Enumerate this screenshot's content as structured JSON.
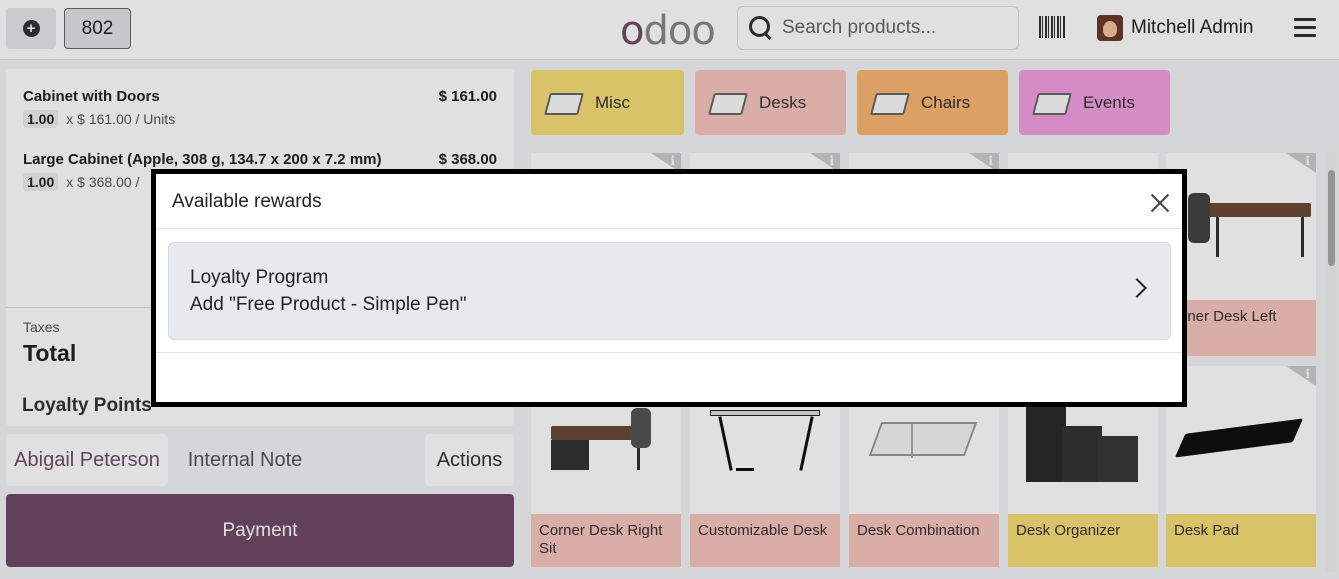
{
  "header": {
    "new_order_icon": "plus-circle-icon",
    "order_number": "802",
    "logo_left": "o",
    "logo_rest": "doo",
    "search_placeholder": "Search products...",
    "barcode_icon": "barcode-icon",
    "user_name": "Mitchell Admin",
    "menu_icon": "hamburger-icon"
  },
  "order": {
    "lines": [
      {
        "name": "Cabinet with Doors",
        "price": "$ 161.00",
        "qty": "1.00",
        "unit_text": "x $ 161.00 / Units"
      },
      {
        "name": "Large Cabinet (Apple, 308 g, 134.7 x 200 x 7.2 mm)",
        "price": "$ 368.00",
        "qty": "1.00",
        "unit_text": "x $ 368.00 /"
      }
    ],
    "taxes_label": "Taxes",
    "total_label": "Total",
    "loyalty_label": "Loyalty Points"
  },
  "actions": {
    "customer": "Abigail Peterson",
    "internal_note": "Internal Note",
    "actions": "Actions",
    "payment": "Payment"
  },
  "categories": [
    {
      "label": "Misc",
      "icon": "misc-icon",
      "color": "#f8de78"
    },
    {
      "label": "Desks",
      "icon": "desk-icon",
      "color": "#f8c7bd"
    },
    {
      "label": "Chairs",
      "icon": "chair-icon",
      "color": "#fbb774"
    },
    {
      "label": "Events",
      "icon": "ticket-icon",
      "color": "#f1a0e1"
    }
  ],
  "products": {
    "top_right_label_line1": "orner Desk Left",
    "top_right_label_line2": "t",
    "bottom": [
      {
        "name": "Corner Desk Right Sit",
        "color": "#f8c7bd"
      },
      {
        "name": "Customizable Desk",
        "color": "#f8c7bd"
      },
      {
        "name": "Desk Combination",
        "color": "#f8c7bd"
      },
      {
        "name": "Desk Organizer",
        "color": "#f8de78"
      },
      {
        "name": "Desk Pad",
        "color": "#f8de78"
      }
    ]
  },
  "dialog": {
    "title": "Available rewards",
    "close_icon": "close-icon",
    "reward": {
      "program": "Loyalty Program",
      "description": "Add \"Free Product - Simple Pen\"",
      "chevron_icon": "chevron-right-icon"
    }
  },
  "colors": {
    "brand": "#714b67",
    "misc": "#f8de78",
    "desks": "#f8c7bd",
    "chairs": "#fbb774",
    "events": "#f1a0e1"
  }
}
